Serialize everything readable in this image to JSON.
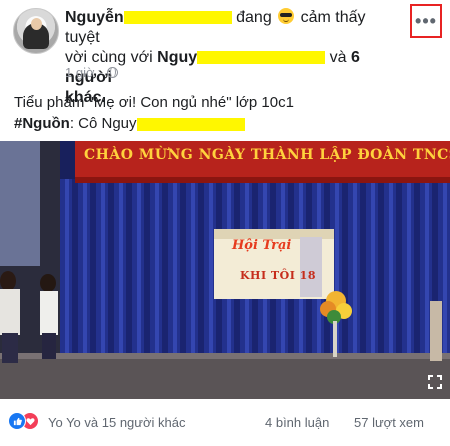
{
  "header": {
    "author_prefix": "Nguyễn",
    "feeling_word": "đang",
    "feeling_text": "cảm thấy tuyệt",
    "with_text": "vời cùng với",
    "tagged_prefix": "Nguy",
    "tagged_suffix": "và",
    "others_count": "6 người",
    "others_suffix": "khác.",
    "time": "1 giờ",
    "emoji_name": "sunglasses-emoji",
    "privacy_icon": "globe-icon",
    "more_icon": "ellipsis-icon",
    "more_label": "•••"
  },
  "caption": {
    "line1": "Tiểu phẩm \"Mẹ ơi! Con ngủ nhé\" lớp 10c1",
    "source_tag": "#Nguồn",
    "source_text": ": Cô Nguy"
  },
  "video": {
    "banner": "CHÀO MỪNG NGÀY THÀNH LẬP ĐOÀN TNCS HỒ CHÍ MINH",
    "poster_line1": "Hội Trại",
    "poster_line2": "KHI TÔI 18"
  },
  "footer": {
    "reactions_text": "Yo Yo và 15 người khác",
    "comments": "4 bình luận",
    "views": "57 lượt xem"
  },
  "colors": {
    "redaction": "#fff700",
    "highlight_box": "#e82323",
    "meta_gray": "#90949c",
    "like_blue": "#1877f2",
    "love_red": "#f33e58"
  }
}
